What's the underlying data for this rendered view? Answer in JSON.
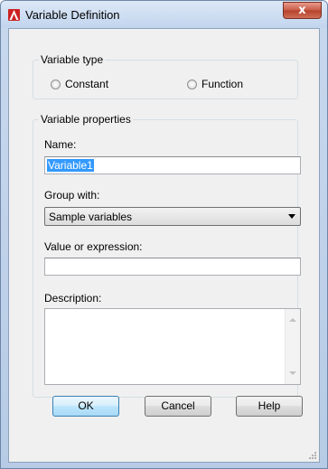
{
  "window": {
    "title": "Variable Definition",
    "close_glyph": "x"
  },
  "variable_type": {
    "legend": "Variable type",
    "options": [
      {
        "label": "Constant",
        "selected": false
      },
      {
        "label": "Function",
        "selected": false
      }
    ]
  },
  "variable_properties": {
    "legend": "Variable properties",
    "name_label": "Name:",
    "name_value": "Variable1",
    "group_label": "Group with:",
    "group_value": "Sample variables",
    "value_label": "Value or expression:",
    "value_value": "",
    "description_label": "Description:",
    "description_value": ""
  },
  "buttons": {
    "ok": "OK",
    "cancel": "Cancel",
    "help": "Help"
  },
  "icons": {
    "app": "autocad-icon",
    "close": "close-icon",
    "dropdown": "chevron-down-icon"
  },
  "colors": {
    "accent": "#3399ff",
    "close_button": "#c75a45",
    "app_icon": "#cc2222"
  }
}
